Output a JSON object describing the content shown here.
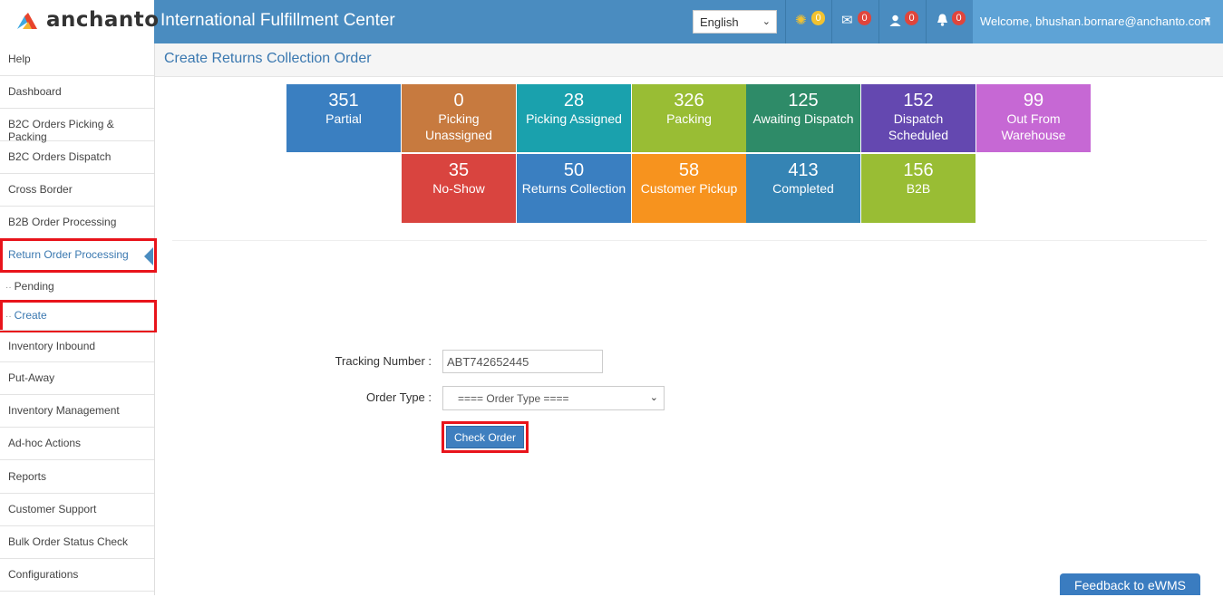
{
  "brand": {
    "logo_text": "anchanto",
    "app_title": "International Fulfillment Center"
  },
  "header": {
    "language": "English",
    "icons": [
      {
        "name": "spinner-icon",
        "glyph": "⁂",
        "count": "0"
      },
      {
        "name": "envelope-icon",
        "glyph": "✉",
        "count": "0"
      },
      {
        "name": "user-icon",
        "glyph": "●",
        "count": "0"
      },
      {
        "name": "bell-icon",
        "glyph": "🔔",
        "count": "0"
      }
    ],
    "welcome": "Welcome, bhushan.bornare@anchanto.com"
  },
  "sidebar": {
    "items": [
      {
        "label": "Help"
      },
      {
        "label": "Dashboard"
      },
      {
        "label": "B2C Orders Picking & Packing"
      },
      {
        "label": "B2C Orders Dispatch"
      },
      {
        "label": "Cross Border"
      },
      {
        "label": "B2B Order Processing"
      },
      {
        "label": "Return Order Processing"
      },
      {
        "label": "Inventory Inbound"
      },
      {
        "label": "Put-Away"
      },
      {
        "label": "Inventory Management"
      },
      {
        "label": "Ad-hoc Actions"
      },
      {
        "label": "Reports"
      },
      {
        "label": "Customer Support"
      },
      {
        "label": "Bulk Order Status Check"
      },
      {
        "label": "Configurations"
      }
    ],
    "sub_items": [
      {
        "label": "Pending"
      },
      {
        "label": "Create"
      }
    ]
  },
  "page": {
    "title": "Create Returns Collection Order"
  },
  "tiles": [
    {
      "num": "351",
      "label": "Partial",
      "color": "#3a7fc1"
    },
    {
      "num": "0",
      "label": "Picking Unassigned",
      "color": "#c77a3f"
    },
    {
      "num": "28",
      "label": "Picking Assigned",
      "color": "#1aa1ad"
    },
    {
      "num": "326",
      "label": "Packing",
      "color": "#99bd34"
    },
    {
      "num": "125",
      "label": "Awaiting Dispatch",
      "color": "#2e8b68"
    },
    {
      "num": "152",
      "label": "Dispatch Scheduled",
      "color": "#6448b0"
    },
    {
      "num": "99",
      "label": "Out From Warehouse",
      "color": "#c668d4"
    },
    {
      "num": "35",
      "label": "No-Show",
      "color": "#d9443f"
    },
    {
      "num": "50",
      "label": "Returns Collection",
      "color": "#3a7fc1"
    },
    {
      "num": "58",
      "label": "Customer Pickup",
      "color": "#f7931e"
    },
    {
      "num": "413",
      "label": "Completed",
      "color": "#3584b4"
    },
    {
      "num": "156",
      "label": "B2B",
      "color": "#99bd34"
    }
  ],
  "form": {
    "tracking_label": "Tracking Number :",
    "tracking_value": "ABT742652445",
    "order_type_label": "Order Type :",
    "order_type_value": "==== Order Type ====",
    "check_button": "Check Order"
  },
  "feedback": "Feedback to eWMS"
}
